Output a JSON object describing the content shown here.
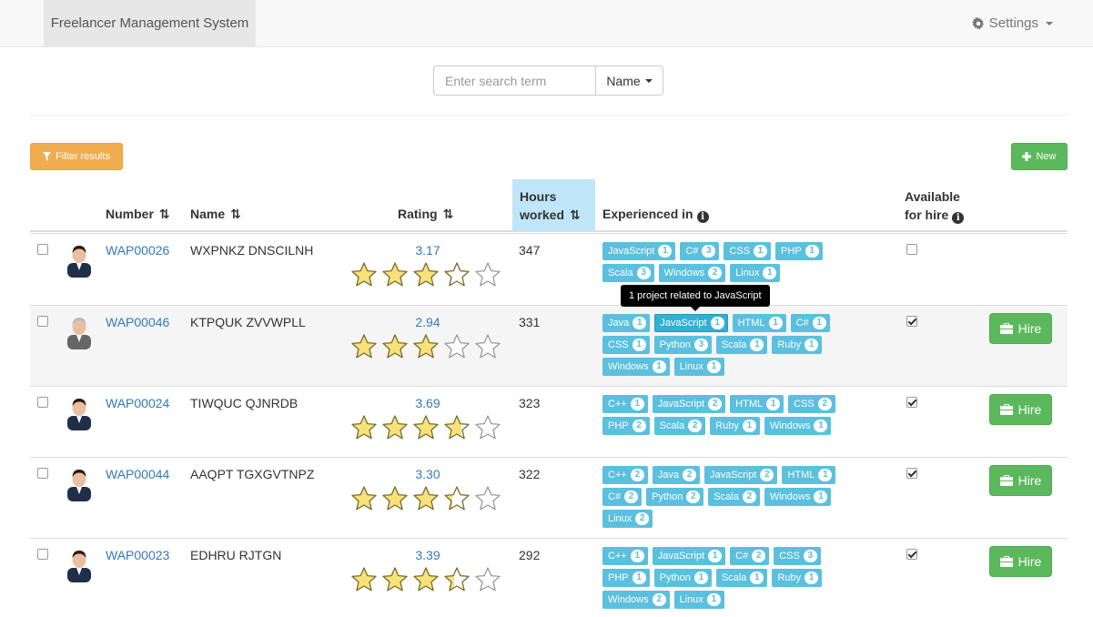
{
  "navbar": {
    "brand": "Freelancer Management System",
    "settings_label": "Settings"
  },
  "search": {
    "placeholder": "Enter search term",
    "field_label": "Name"
  },
  "toolbar": {
    "filter_label": "Filter results",
    "new_label": "New"
  },
  "columns": {
    "number": "Number",
    "name": "Name",
    "rating": "Rating",
    "hours_line1": "Hours",
    "hours_line2": "worked",
    "experienced": "Experienced in",
    "available_line1": "Available",
    "available_line2": "for hire"
  },
  "sort_icon": "⇅",
  "hire_label": "Hire",
  "tooltip": "1 project related to JavaScript",
  "colors": {
    "link": "#337ab7",
    "tag": "#5bc0de",
    "success": "#5cb85c",
    "warning": "#f0ad4e",
    "sorted_header": "#bfe6f8"
  },
  "rows": [
    {
      "number": "WAP00026",
      "name": "WXPNKZ DNSCILNH",
      "rating": "3.17",
      "rating_value": 3.17,
      "hours": "347",
      "available": false,
      "tags": [
        [
          "JavaScript",
          "1"
        ],
        [
          "C#",
          "3"
        ],
        [
          "CSS",
          "1"
        ],
        [
          "PHP",
          "1"
        ],
        [
          "Scala",
          "3"
        ],
        [
          "Windows",
          "2"
        ],
        [
          "Linux",
          "1"
        ]
      ]
    },
    {
      "number": "WAP00046",
      "name": "KTPQUK ZVVWPLL",
      "rating": "2.94",
      "rating_value": 2.94,
      "hours": "331",
      "available": true,
      "tags": [
        [
          "Java",
          "1"
        ],
        [
          "JavaScript",
          "1"
        ],
        [
          "HTML",
          "1"
        ],
        [
          "C#",
          "1"
        ],
        [
          "CSS",
          "1"
        ],
        [
          "Python",
          "3"
        ],
        [
          "Scala",
          "1"
        ],
        [
          "Ruby",
          "1"
        ],
        [
          "Windows",
          "1"
        ],
        [
          "Linux",
          "1"
        ]
      ]
    },
    {
      "number": "WAP00024",
      "name": "TIWQUC QJNRDB",
      "rating": "3.69",
      "rating_value": 3.69,
      "hours": "323",
      "available": true,
      "tags": [
        [
          "C++",
          "1"
        ],
        [
          "JavaScript",
          "2"
        ],
        [
          "HTML",
          "1"
        ],
        [
          "CSS",
          "2"
        ],
        [
          "PHP",
          "2"
        ],
        [
          "Scala",
          "2"
        ],
        [
          "Ruby",
          "1"
        ],
        [
          "Windows",
          "1"
        ]
      ]
    },
    {
      "number": "WAP00044",
      "name": "AAQPT TGXGVTNPZ",
      "rating": "3.30",
      "rating_value": 3.3,
      "hours": "322",
      "available": true,
      "tags": [
        [
          "C++",
          "2"
        ],
        [
          "Java",
          "2"
        ],
        [
          "JavaScript",
          "2"
        ],
        [
          "HTML",
          "1"
        ],
        [
          "C#",
          "2"
        ],
        [
          "Python",
          "2"
        ],
        [
          "Scala",
          "2"
        ],
        [
          "Windows",
          "1"
        ],
        [
          "Linux",
          "2"
        ]
      ]
    },
    {
      "number": "WAP00023",
      "name": "EDHRU RJTGN",
      "rating": "3.39",
      "rating_value": 3.39,
      "hours": "292",
      "available": true,
      "tags": [
        [
          "C++",
          "1"
        ],
        [
          "JavaScript",
          "1"
        ],
        [
          "C#",
          "2"
        ],
        [
          "CSS",
          "3"
        ],
        [
          "PHP",
          "1"
        ],
        [
          "Python",
          "1"
        ],
        [
          "Scala",
          "1"
        ],
        [
          "Ruby",
          "1"
        ],
        [
          "Windows",
          "2"
        ],
        [
          "Linux",
          "1"
        ]
      ]
    }
  ]
}
